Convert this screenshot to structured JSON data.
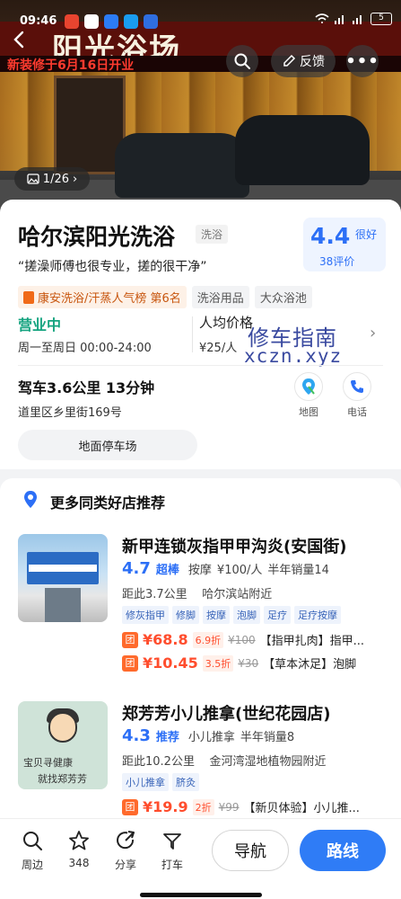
{
  "status_bar": {
    "time": "09:46",
    "battery": "5"
  },
  "hero": {
    "sign_text": "阳光浴场",
    "led_text": "新装修于6月16日开业",
    "photo_counter": "1/26"
  },
  "top_actions": {
    "feedback_label": "反馈"
  },
  "shop": {
    "name": "哈尔滨阳光洗浴",
    "category": "洗浴",
    "rating": "4.4",
    "rating_word": "很好",
    "review_count": "38评价",
    "quote": "“搓澡师傅也很专业，搓的很干净”",
    "rank_label": "康安洗浴/汗蒸人气榜 第6名",
    "tags": [
      "洗浴用品",
      "大众浴池"
    ],
    "open_status": "营业中",
    "open_hours": "周一至周日 00:00-24:00",
    "price_label": "人均价格",
    "price_value": "¥25/人",
    "drive_info": "驾车3.6公里  13分钟",
    "address": "道里区乡里街169号",
    "map_label": "地图",
    "call_label": "电话",
    "parking_label": "地面停车场"
  },
  "watermark": {
    "line1": "修车指南",
    "line2": "xczn.xyz"
  },
  "recommend": {
    "title": "更多同类好店推荐",
    "items": [
      {
        "name": "新甲连锁灰指甲甲沟炎(安国街)",
        "score": "4.7",
        "score_word": "超棒",
        "category": "按摩",
        "price": "¥100/人",
        "sales": "半年销量14",
        "distance": "距此3.7公里",
        "area": "哈尔滨站附近",
        "tags": [
          "修灰指甲",
          "修脚",
          "按摩",
          "泡脚",
          "足疗",
          "足疗按摩"
        ],
        "deals": [
          {
            "badge": "团",
            "price": "¥68.8",
            "discount": "6.9折",
            "original": "¥100",
            "name": "【指甲扎肉】指甲..."
          },
          {
            "badge": "团",
            "price": "¥10.45",
            "discount": "3.5折",
            "original": "¥30",
            "name": "【草本沐足】泡脚"
          }
        ]
      },
      {
        "name": "郑芳芳小儿推拿(世纪花园店)",
        "score": "4.3",
        "score_word": "推荐",
        "category": "小儿推拿",
        "price": "",
        "sales": "半年销量8",
        "distance": "距此10.2公里",
        "area": "金河湾湿地植物园附近",
        "tags": [
          "小儿推拿",
          "脐灸"
        ],
        "thumb_text1": "宝贝寻健康",
        "thumb_text2": "就找郑芳芳",
        "deals": [
          {
            "badge": "团",
            "price": "¥19.9",
            "discount": "2折",
            "original": "¥99",
            "name": "【新贝体验】小儿推..."
          }
        ]
      }
    ]
  },
  "bottom_bar": {
    "nearby": "周边",
    "favorite_count": "348",
    "share": "分享",
    "taxi": "打车",
    "navigate": "导航",
    "route": "路线"
  },
  "colors": {
    "accent": "#2f7cf6",
    "open_green": "#14a37f",
    "deal_red": "#ff4d2d"
  }
}
